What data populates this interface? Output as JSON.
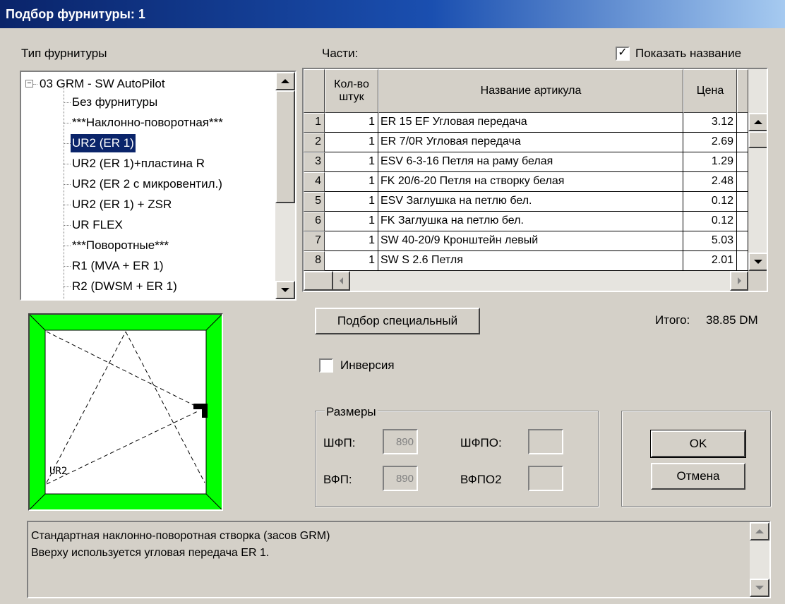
{
  "window": {
    "title": "Подбор фурнитуры: 1"
  },
  "labels": {
    "type": "Тип фурнитуры",
    "parts": "Части:",
    "show_name": "Показать название",
    "total": "Итого:",
    "total_value": "38.85 DM",
    "inversion": "Инверсия",
    "sizes": "Размеры",
    "shfp": "ШФП:",
    "shfpo": "ШФПО:",
    "vfp": "ВФП:",
    "vfpo": "ВФПО2"
  },
  "tree": {
    "root": "03 GRM - SW AutoPilot",
    "items": [
      "Без фурнитуры",
      "***Наклонно-поворотная***",
      "UR2 (ER 1)",
      "UR2 (ER 1)+пластина R",
      "UR2 (ER 2 с микровентил.)",
      "UR2 (ER 1) + ZSR",
      "UR    FLEX",
      "***Поворотные***",
      "R1 (MVA + ER 1)",
      "R2 (DWSM + ER 1)"
    ],
    "selected_index": 2
  },
  "table": {
    "headers": {
      "qty_line1": "Кол-во",
      "qty_line2": "штук",
      "name": "Название артикула",
      "price": "Цена"
    },
    "rows": [
      {
        "num": "1",
        "qty": "1",
        "name": "ER 15 EF Угловая передача",
        "price": "3.12"
      },
      {
        "num": "2",
        "qty": "1",
        "name": "ER 7/0R Угловая передача",
        "price": "2.69"
      },
      {
        "num": "3",
        "qty": "1",
        "name": "ESV 6-3-16 Петля на раму белая",
        "price": "1.29"
      },
      {
        "num": "4",
        "qty": "1",
        "name": "FK 20/6-20 Петля на створку белая",
        "price": "2.48"
      },
      {
        "num": "5",
        "qty": "1",
        "name": "ESV Заглушка на петлю бел.",
        "price": "0.12"
      },
      {
        "num": "6",
        "qty": "1",
        "name": "FK Заглушка на петлю бел.",
        "price": "0.12"
      },
      {
        "num": "7",
        "qty": "1",
        "name": "SW 40-20/9 Кронштейн левый",
        "price": "5.03"
      },
      {
        "num": "8",
        "qty": "1",
        "name": "SW S 2.6 Петля",
        "price": "2.01"
      }
    ]
  },
  "checkboxes": {
    "show_name_checked": true,
    "inversion_checked": false
  },
  "fields": {
    "shfp_value": "890",
    "shfpo_value": "",
    "vfp_value": "890",
    "vfpo_value": ""
  },
  "buttons": {
    "special": "Подбор специальный",
    "ok": "OK",
    "cancel": "Отмена"
  },
  "preview": {
    "label": "UR2",
    "frame_color": "#00ff00"
  },
  "description": {
    "line1": "Стандартная наклонно-поворотная створка (засов GRM)",
    "line2": "Вверху используется угловая передача ER 1."
  }
}
